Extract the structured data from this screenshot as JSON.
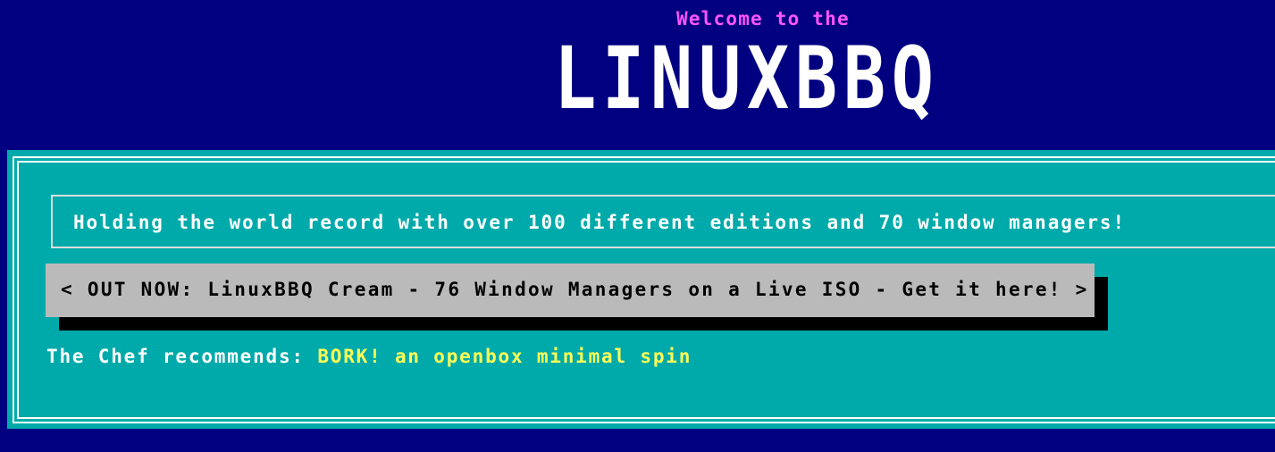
{
  "header": {
    "welcome": "Welcome to the",
    "logo": "LINUXBBQ"
  },
  "panel": {
    "record": "Holding the world record with over 100 different editions and 70 window managers!",
    "cta_button": "< OUT NOW: LinuxBBQ Cream - 76 Window Managers on a Live ISO - Get it here! >",
    "chef_label": "The Chef recommends: ",
    "chef_link": "BORK! an openbox minimal spin"
  },
  "colors": {
    "background": "#000080",
    "panel": "#00aaaa",
    "welcome": "#ff55ff",
    "button": "#bababa",
    "link": "#ffff55"
  }
}
